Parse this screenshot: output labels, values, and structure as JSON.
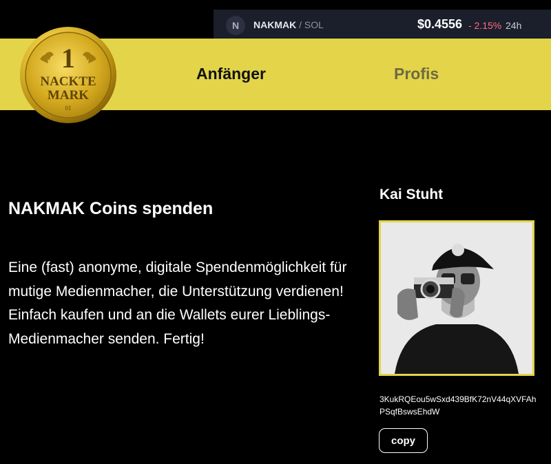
{
  "ticker": {
    "badge": "N",
    "symbol": "NAKMAK",
    "separator": " / ",
    "quote": "SOL",
    "price": "$0.4556",
    "change": "- 2.15%",
    "period": "24h"
  },
  "logo": {
    "numeral": "1",
    "line1": "NACKTE",
    "line2": "MARK",
    "year": "01"
  },
  "nav": {
    "beginner": "Anfänger",
    "pros": "Profis"
  },
  "main": {
    "title": "NAKMAK Coins spenden",
    "description_line1": "Eine (fast) anonyme, digitale Spendenmöglichkeit für mutige Medienmacher, die Unterstützung verdienen!",
    "description_line2": "Einfach kaufen und an die Wallets eurer Lieblings-Medienmacher senden. Fertig!"
  },
  "creator": {
    "name": "Kai Stuht",
    "wallet": "3KukRQEou5wSxd439BfK72nV44qXVFAhPSqfBswsEhdW",
    "copy_label": "copy"
  },
  "colors": {
    "accent_yellow": "#e3d44a",
    "ticker_bg": "#1b1e2b",
    "negative": "#ff6b81",
    "background": "#000000"
  }
}
